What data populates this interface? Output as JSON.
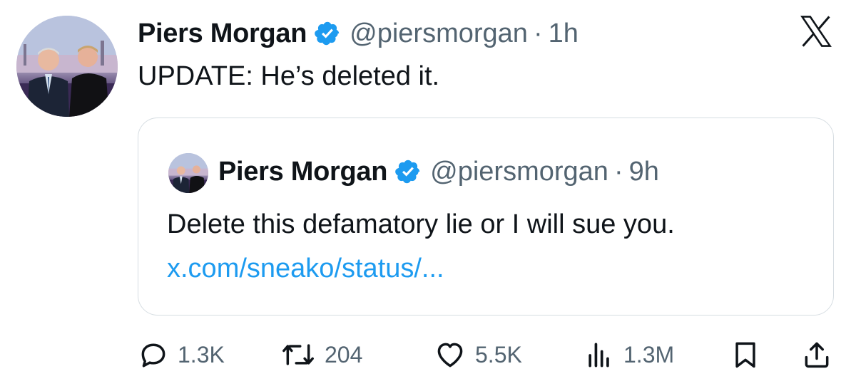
{
  "tweet": {
    "author_name": "Piers Morgan",
    "handle": "@piersmorgan",
    "separator": "·",
    "time": "1h",
    "text": "UPDATE: He’s deleted it."
  },
  "quoted_tweet": {
    "author_name": "Piers Morgan",
    "handle": "@piersmorgan",
    "separator": "·",
    "time": "9h",
    "text": "Delete this defamatory lie or I will sue you.",
    "link": "x.com/sneako/status/..."
  },
  "actions": {
    "replies": "1.3K",
    "reposts": "204",
    "likes": "5.5K",
    "views": "1.3M"
  },
  "icons": {
    "reply": "reply-icon",
    "repost": "repost-icon",
    "like": "heart-icon",
    "views": "views-icon",
    "bookmark": "bookmark-icon",
    "share": "share-icon",
    "brand": "x-logo-icon",
    "verified": "verified-badge-icon"
  },
  "colors": {
    "verified": "#1d9bf0",
    "link": "#1d9bf0",
    "secondary_text": "#536471",
    "primary_text": "#0f1419",
    "border": "#d6dde2"
  }
}
